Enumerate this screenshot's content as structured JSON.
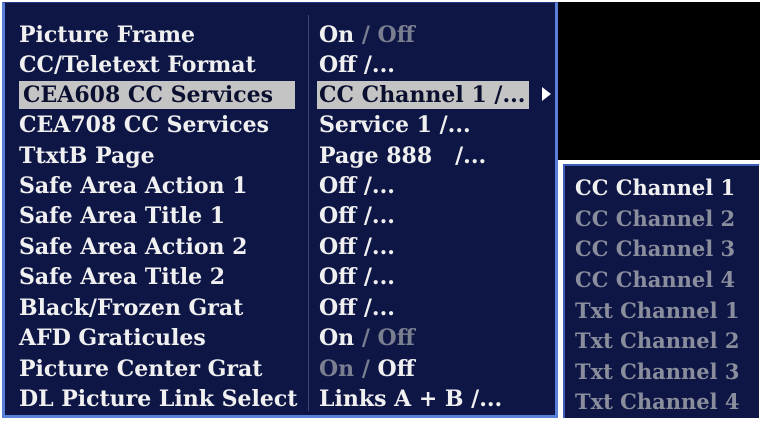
{
  "menu": {
    "rows": [
      {
        "label": "Picture Frame",
        "value_main": "On",
        "value_sep": " / ",
        "value_alt": "Off"
      },
      {
        "label": "CC/Teletext Format",
        "value_main": "Off /..."
      },
      {
        "label": "CEA608 CC Services",
        "value_main": "CC Channel 1 /..."
      },
      {
        "label": "CEA708 CC Services",
        "value_main": "Service 1 /..."
      },
      {
        "label": "TtxtB Page",
        "value_main": "Page 888   /..."
      },
      {
        "label": "Safe Area Action 1",
        "value_main": "Off /..."
      },
      {
        "label": "Safe Area Title 1",
        "value_main": "Off /..."
      },
      {
        "label": "Safe Area Action 2",
        "value_main": "Off /..."
      },
      {
        "label": "Safe Area Title 2",
        "value_main": "Off /..."
      },
      {
        "label": "Black/Frozen Grat",
        "value_main": "Off /..."
      },
      {
        "label": "AFD Graticules",
        "value_main": "On",
        "value_sep": " / ",
        "value_alt": "Off"
      },
      {
        "label": "Picture Center Grat",
        "value_dim": "On",
        "value_sep": " / ",
        "value_main": "Off"
      },
      {
        "label": "DL Picture Link Select",
        "value_main": "Links A + B /..."
      }
    ]
  },
  "submenu": {
    "items": [
      "CC Channel 1",
      "CC Channel 2",
      "CC Channel 3",
      "CC Channel 4",
      "Txt Channel 1",
      "Txt Channel 2",
      "Txt Channel 3",
      "Txt Channel 4"
    ]
  },
  "colors": {
    "panel_bg": "#0e1646",
    "panel_border": "#5a7fd8",
    "selection": "#c4c4c4",
    "text": "#f0f0f0",
    "dim_text": "#7a7f90"
  },
  "icons": {
    "submenu_arrow": "right-triangle-icon"
  }
}
